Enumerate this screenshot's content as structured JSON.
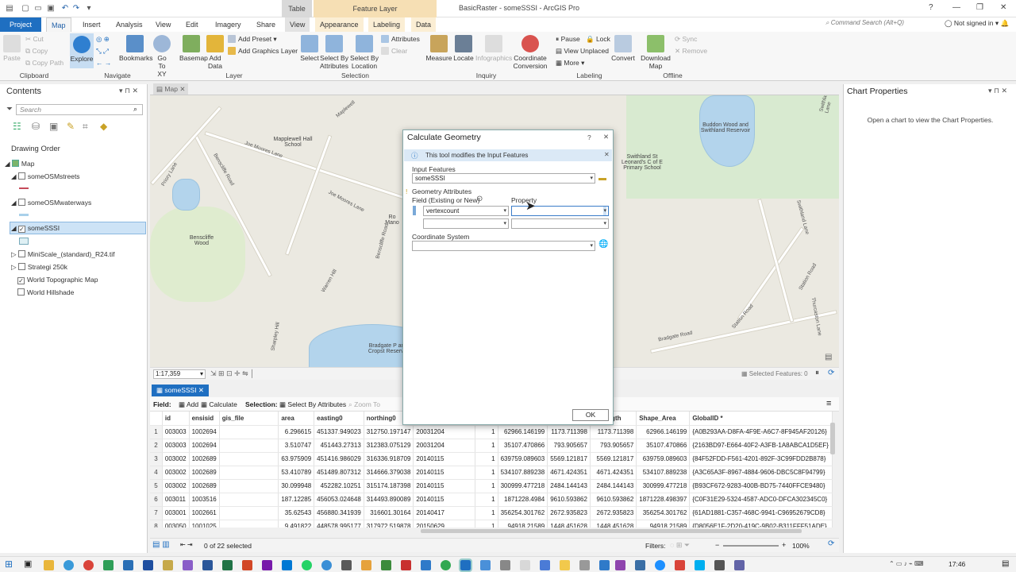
{
  "titlebar": {
    "title": "BasicRaster - someSSSI - ArcGIS Pro",
    "context_table": "Table",
    "context_feature_layer": "Feature Layer",
    "help": "?",
    "minimize": "—",
    "restore": "❐",
    "close": "✕"
  },
  "tabs": [
    "Project",
    "Map",
    "Insert",
    "Analysis",
    "View",
    "Edit",
    "Imagery",
    "Share",
    "View",
    "Appearance",
    "Labeling",
    "Data"
  ],
  "command_search": "Command Search (Alt+Q)",
  "user": "Not signed in",
  "ribbon": {
    "paste": "Paste",
    "cut": "Cut",
    "copy": "Copy",
    "copy_path": "Copy Path",
    "clipboard": "Clipboard",
    "explore": "Explore",
    "bookmarks": "Bookmarks",
    "go_to_xy": "Go To XY",
    "navigate": "Navigate",
    "basemap": "Basemap",
    "add_data": "Add Data",
    "add_preset": "Add Preset",
    "add_graphics_layer": "Add Graphics Layer",
    "layer": "Layer",
    "select": "Select",
    "select_by_attributes": "Select By Attributes",
    "select_by_location": "Select By Location",
    "attributes": "Attributes",
    "clear": "Clear",
    "selection": "Selection",
    "measure": "Measure",
    "locate": "Locate",
    "infographics": "Infographics",
    "coordinate_conversion": "Coordinate Conversion",
    "inquiry": "Inquiry",
    "pause": "Pause",
    "lock": "Lock",
    "view_unplaced": "View Unplaced",
    "more": "More",
    "labeling": "Labeling",
    "convert": "Convert",
    "download_map": "Download Map",
    "sync": "Sync",
    "remove": "Remove",
    "offline": "Offline"
  },
  "contents": {
    "title": "Contents",
    "search_placeholder": "Search",
    "drawing_order": "Drawing Order",
    "layers": [
      {
        "name": "Map",
        "checked": true
      },
      {
        "name": "someOSMstreets",
        "checked": false
      },
      {
        "name": "someOSMwaterways",
        "checked": false
      },
      {
        "name": "someSSSI",
        "checked": true
      },
      {
        "name": "MiniScale_(standard)_R24.tif",
        "checked": false
      },
      {
        "name": "Strategi 250k",
        "checked": false
      },
      {
        "name": "World Topographic Map",
        "checked": true
      },
      {
        "name": "World Hillshade",
        "checked": false
      }
    ]
  },
  "map": {
    "tab": "Map",
    "scale": "1:17,359",
    "selected_features": "Selected Features: 0",
    "labels": {
      "mapplewell": "Mapplewell Hall School",
      "bradgate": "Bradgate P and Cropst Reservoi",
      "buddon": "Buddon Wood and Swithland Reservoir",
      "swithland": "Swithland St Leonard's C of E Primary School",
      "benscliffe": "Benscliffe Wood",
      "roecliffe": "Ro Mano"
    },
    "roads": {
      "joe_moores": "Joe Moores Lane",
      "joe_moores2": "Joe Moores Lane",
      "priory": "Priory Lane",
      "benscliffe_rd": "Benscliffe Road",
      "benscliffe_rd2": "Benscliffe Road",
      "warren": "Warren Hill",
      "sharpley": "Sharpley Hill",
      "bradgate_rd": "Bradgate Road",
      "station": "Station Road",
      "station2": "Station Road",
      "swithland_ln": "Swithland Lane",
      "swithland_ln2": "Swithland Lane",
      "thurcaston": "Thurcaston Lane",
      "maplewell": "Maplewell"
    }
  },
  "chart_properties": {
    "title": "Chart Properties",
    "message": "Open a chart to view the Chart Properties."
  },
  "table": {
    "tab": "someSSSI",
    "field": "Field:",
    "add": "Add",
    "calculate": "Calculate",
    "selection": "Selection:",
    "select_by_attributes": "Select By Attributes",
    "zoom_to": "Zoom To",
    "columns": [
      "",
      "id",
      "ensisid",
      "gis_file",
      "area",
      "easting0",
      "northing0",
      "",
      "",
      "",
      "",
      "e_Length",
      "Shape_Area",
      "GlobalID *"
    ],
    "rows": [
      [
        "1",
        "003003",
        "1002694",
        "",
        "6.296615",
        "451337.949023",
        "312750.197147",
        "20031204",
        "1",
        "62966.146199",
        "1173.711398",
        "1173.711398",
        "62966.146199",
        "{A0B293AA-D8FA-4F9E-A6C7-8F945AF20126}"
      ],
      [
        "2",
        "003003",
        "1002694",
        "",
        "3.510747",
        "451443.27313",
        "312383.075129",
        "20031204",
        "1",
        "35107.470866",
        "793.905657",
        "793.905657",
        "35107.470866",
        "{2163BD97-E664-40F2-A3FB-1A8ABCA1D5EF}"
      ],
      [
        "3",
        "003002",
        "1002689",
        "",
        "63.975909",
        "451416.986029",
        "316336.918709",
        "20140115",
        "1",
        "639759.089603",
        "5569.121817",
        "5569.121817",
        "639759.089603",
        "{84F52FDD-F561-4201-892F-3C99FDD2B878}"
      ],
      [
        "4",
        "003002",
        "1002689",
        "",
        "53.410789",
        "451489.807312",
        "314666.379038",
        "20140115",
        "1",
        "534107.889238",
        "4671.424351",
        "4671.424351",
        "534107.889238",
        "{A3C65A3F-8967-4884-9606-DBC5C8F94799}"
      ],
      [
        "5",
        "003002",
        "1002689",
        "",
        "30.099948",
        "452282.10251",
        "315174.187398",
        "20140115",
        "1",
        "300999.477218",
        "2484.144143",
        "2484.144143",
        "300999.477218",
        "{B93CF672-9283-400B-BD75-7440FFCE9480}"
      ],
      [
        "6",
        "003011",
        "1003516",
        "",
        "187.12285",
        "456053.024648",
        "314493.890089",
        "20140115",
        "1",
        "1871228.4984",
        "9610.593862",
        "9610.593862",
        "1871228.498397",
        "{C0F31E29-5324-4587-ADC0-DFCA302345C0}"
      ],
      [
        "7",
        "003001",
        "1002661",
        "",
        "35.62543",
        "456880.341939",
        "316601.30164",
        "20140417",
        "1",
        "356254.301762",
        "2672.935823",
        "2672.935823",
        "356254.301762",
        "{61AD1881-C357-468C-9941-C96952679CD8}"
      ],
      [
        "8",
        "003050",
        "1001025",
        "",
        "9.491822",
        "448578.995177",
        "317972.519878",
        "20150629",
        "1",
        "94918.21589",
        "1448.451628",
        "1448.451628",
        "94918.21589",
        "{D8056E1F-2D20-419C-9B02-B311FFF51ADE}"
      ]
    ],
    "selected_count": "0 of 22 selected",
    "filters": "Filters:",
    "zoom": "100%"
  },
  "dialog": {
    "title": "Calculate Geometry",
    "help": "?",
    "close": "✕",
    "info": "This tool modifies the Input Features",
    "input_features_label": "Input Features",
    "input_features_value": "someSSSI",
    "geometry_attributes": "Geometry Attributes",
    "field_label": "Field (Existing or New)",
    "property_label": "Property",
    "field_value": "vertexcount",
    "property_value": "",
    "coord_system_label": "Coordinate System",
    "coord_system_value": "",
    "ok": "OK"
  },
  "taskbar": {
    "time": "17:46"
  },
  "colors": {
    "project_tab": "#1f6fc1",
    "accent": "#1f5fa8",
    "context_feature": "#f6dfb4",
    "water": "#b3d4ec",
    "park": "#d8ead0"
  }
}
